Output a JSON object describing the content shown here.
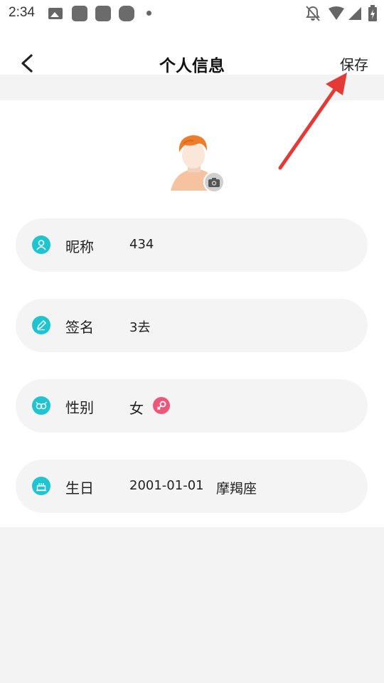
{
  "status_bar": {
    "time": "2:34",
    "icons": [
      "image-icon",
      "notification-icon",
      "notification-icon",
      "notification-icon",
      "dot-icon",
      "bell-off-icon",
      "wifi-icon",
      "signal-icon",
      "battery-charging-icon"
    ]
  },
  "header": {
    "title": "个人信息",
    "back_icon": "chevron-left-icon",
    "save_label": "保存"
  },
  "profile": {
    "avatar_icon": "avatar-boy-icon",
    "camera_icon": "camera-icon",
    "fields": [
      {
        "label": "昵称",
        "value": "434",
        "icon": "user-icon"
      },
      {
        "label": "签名",
        "value": "3去",
        "icon": "pen-icon"
      },
      {
        "label": "性别",
        "value": "女",
        "icon": "gender-icon",
        "badge_icon": "female-symbol-icon"
      },
      {
        "label": "生日",
        "value": "2001-01-01",
        "extra": "摩羯座",
        "icon": "cake-icon"
      }
    ]
  },
  "colors": {
    "accent": "#1ec4d0",
    "female": "#f0567a",
    "annotation_arrow": "#e53935"
  }
}
